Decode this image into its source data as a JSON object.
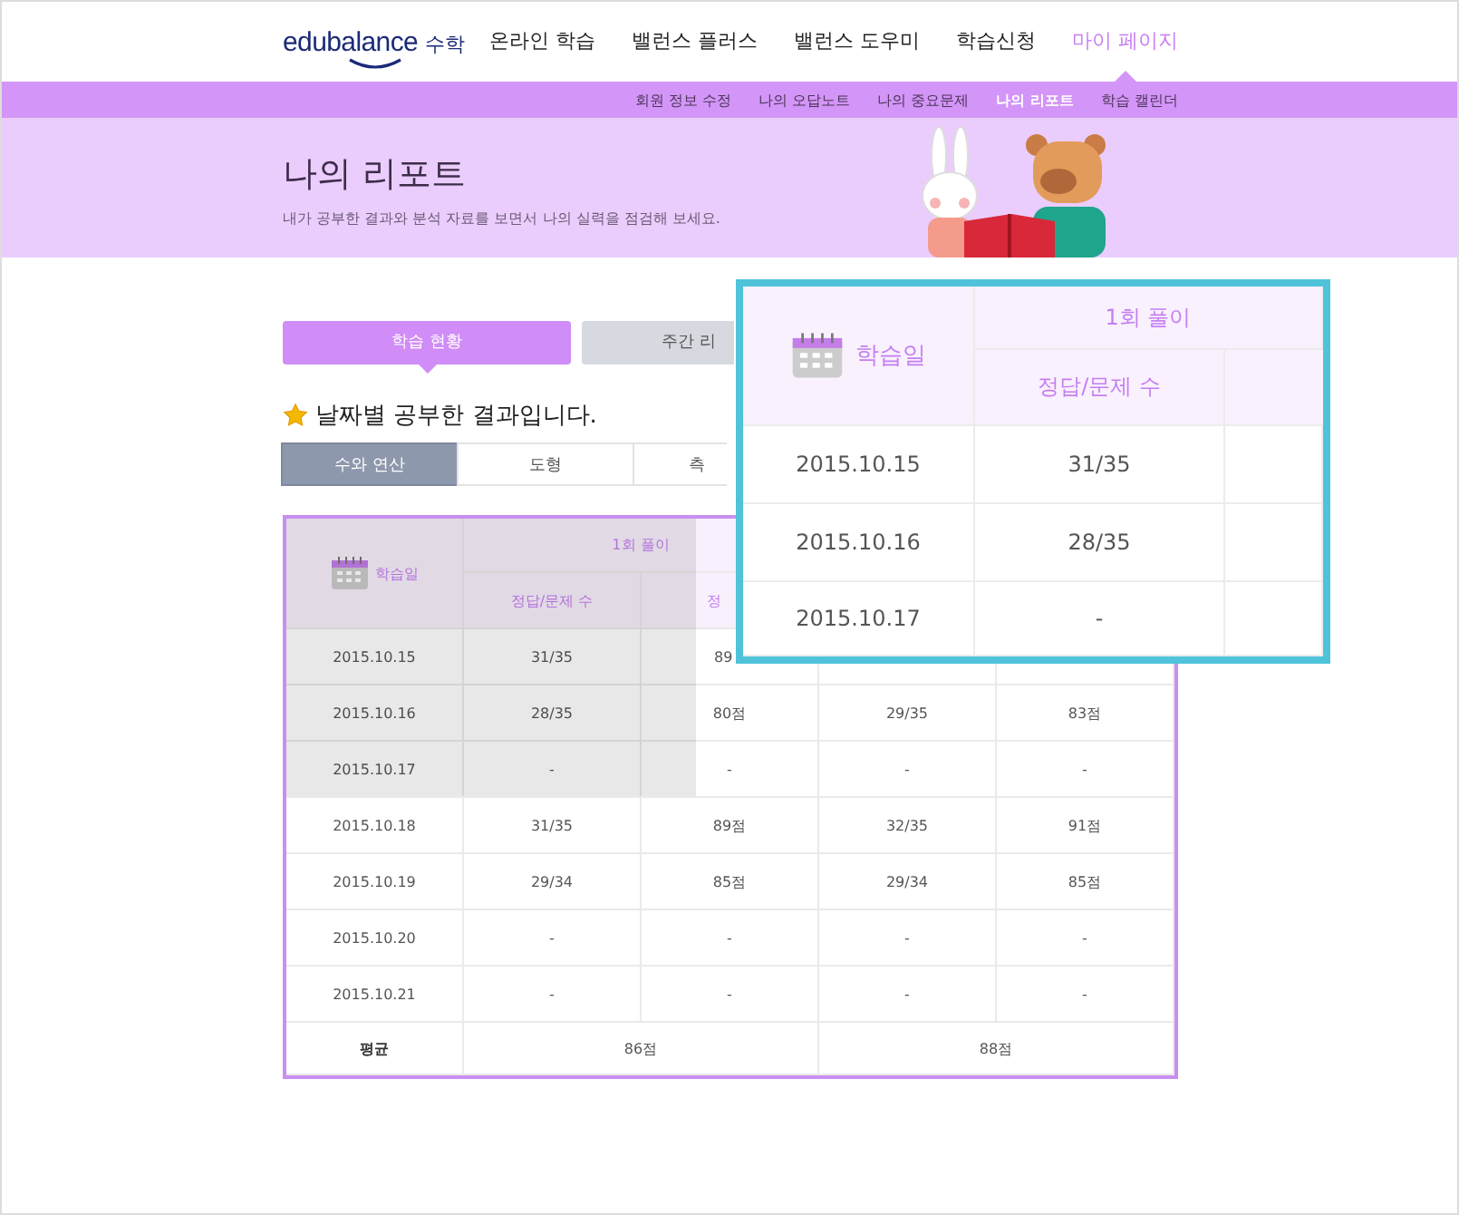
{
  "logo": {
    "brand": "edubalance",
    "subject": "수학"
  },
  "nav": [
    {
      "label": "온라인 학습",
      "selected": false
    },
    {
      "label": "밸런스 플러스",
      "selected": false
    },
    {
      "label": "밸런스 도우미",
      "selected": false
    },
    {
      "label": "학습신청",
      "selected": false
    },
    {
      "label": "마이 페이지",
      "selected": true
    }
  ],
  "subnav": [
    {
      "label": "회원 정보 수정",
      "selected": false
    },
    {
      "label": "나의 오답노트",
      "selected": false
    },
    {
      "label": "나의 중요문제",
      "selected": false
    },
    {
      "label": "나의 리포트",
      "selected": true
    },
    {
      "label": "학습 캘린더",
      "selected": false
    }
  ],
  "banner": {
    "title": "나의 리포트",
    "subtitle": "내가 공부한 결과와 분석 자료를 보면서 나의 실력을 점검해 보세요."
  },
  "tabs": [
    {
      "label": "학습 현황",
      "selected": true
    },
    {
      "label": "주간 리",
      "selected": false
    }
  ],
  "section_title": "날짜별 공부한 결과입니다.",
  "subtabs": [
    {
      "label": "수와 연산",
      "selected": true
    },
    {
      "label": "도형",
      "selected": false
    },
    {
      "label": "측",
      "selected": false
    }
  ],
  "table": {
    "date_header": "학습일",
    "groups": [
      "1회 풀이"
    ],
    "subheaders": [
      "정답/문제 수",
      "정"
    ],
    "rows": [
      [
        "2015.10.15",
        "31/35",
        "89"
      ],
      [
        "2015.10.16",
        "28/35",
        "80점",
        "29/35",
        "83점"
      ],
      [
        "2015.10.17",
        "-",
        "-",
        "-",
        "-"
      ],
      [
        "2015.10.18",
        "31/35",
        "89점",
        "32/35",
        "91점"
      ],
      [
        "2015.10.19",
        "29/34",
        "85점",
        "29/34",
        "85점"
      ],
      [
        "2015.10.20",
        "-",
        "-",
        "-",
        "-"
      ],
      [
        "2015.10.21",
        "-",
        "-",
        "-",
        "-"
      ]
    ],
    "average_label": "평균",
    "averages": [
      "86점",
      "88점"
    ]
  },
  "callout": {
    "date_header": "학습일",
    "group_header": "1회 풀이",
    "subheader": "정답/문제 수",
    "rows": [
      [
        "2015.10.15",
        "31/35"
      ],
      [
        "2015.10.16",
        "28/35"
      ],
      [
        "2015.10.17",
        "-"
      ]
    ]
  }
}
